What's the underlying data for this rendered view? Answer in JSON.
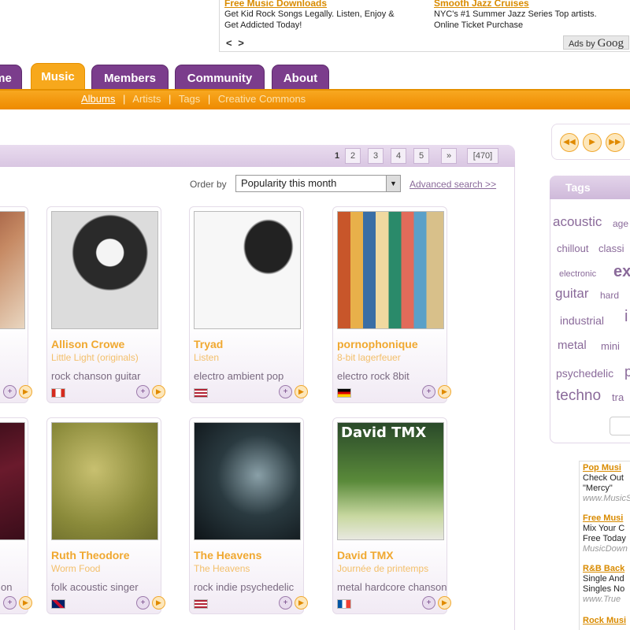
{
  "ads": {
    "ad1": {
      "title": "Free Music Downloads",
      "text": "Get Kid Rock Songs Legally. Listen, Enjoy & Get Addicted Today!"
    },
    "ad2": {
      "title": "Smooth Jazz Cruises",
      "text": "NYC's #1 Summer Jazz Series Top artists. Online Ticket Purchase"
    },
    "nav": "< >",
    "ads_by": "Ads by",
    "google": "Goog"
  },
  "tabs": [
    {
      "label": "Home"
    },
    {
      "label": "Music"
    },
    {
      "label": "Members"
    },
    {
      "label": "Community"
    },
    {
      "label": "About"
    }
  ],
  "subnav": {
    "items": [
      "Albums",
      "Artists",
      "Tags",
      "Creative Commons"
    ],
    "separator": "|"
  },
  "pagination": {
    "pages": [
      "1",
      "2",
      "3",
      "4",
      "5"
    ],
    "next": "»",
    "total": "[470]"
  },
  "order": {
    "label": "Order by",
    "selected": "Popularity this month",
    "advanced_search": "Advanced search >>"
  },
  "albums": [
    {
      "artist": "Allison Crowe",
      "album": "Little Light (originals)",
      "tags": "rock chanson guitar",
      "flag": "canada"
    },
    {
      "artist": "Tryad",
      "album": "Listen",
      "tags": "electro ambient pop",
      "flag": "usa"
    },
    {
      "artist": "pornophonique",
      "album": "8-bit lagerfeuer",
      "tags": "electro rock 8bit",
      "flag": "germany"
    },
    {
      "artist": "Ruth Theodore",
      "album": "Worm Food",
      "tags": "folk acoustic singer",
      "flag": "uk"
    },
    {
      "artist": "The Heavens",
      "album": "The Heavens",
      "tags": "rock indie psychedelic",
      "flag": "usa"
    },
    {
      "artist": "David TMX",
      "album": "Journée de printemps",
      "tags": "metal hardcore chanson",
      "flag": "france"
    }
  ],
  "partial_left": {
    "tags_row2": "on"
  },
  "cover_text": {
    "david": "David TMX"
  },
  "tags_panel": {
    "title": "Tags",
    "tags": [
      "acoustic",
      "age",
      "chillout",
      "classi",
      "electronic",
      "ex",
      "guitar",
      "hard",
      "industrial",
      "i",
      "metal",
      "mini",
      "psychedelic",
      "p",
      "techno",
      "tra"
    ]
  },
  "right_ads": [
    {
      "title": "Pop Musi",
      "lines": [
        "Check Out",
        "\"Mercy\""
      ],
      "url": "www.MusicS"
    },
    {
      "title": "Free Musi",
      "lines": [
        "Mix Your C",
        "Free Today"
      ],
      "url": "MusicDown"
    },
    {
      "title": "R&B Back",
      "lines": [
        "Single And",
        "Singles No"
      ],
      "url": "www.True"
    },
    {
      "title": "Rock Musi",
      "lines": [],
      "url": ""
    }
  ],
  "colors": {
    "purple": "#7b3d8c",
    "orange": "#f7a81c",
    "artist_text": "#f0a830"
  }
}
